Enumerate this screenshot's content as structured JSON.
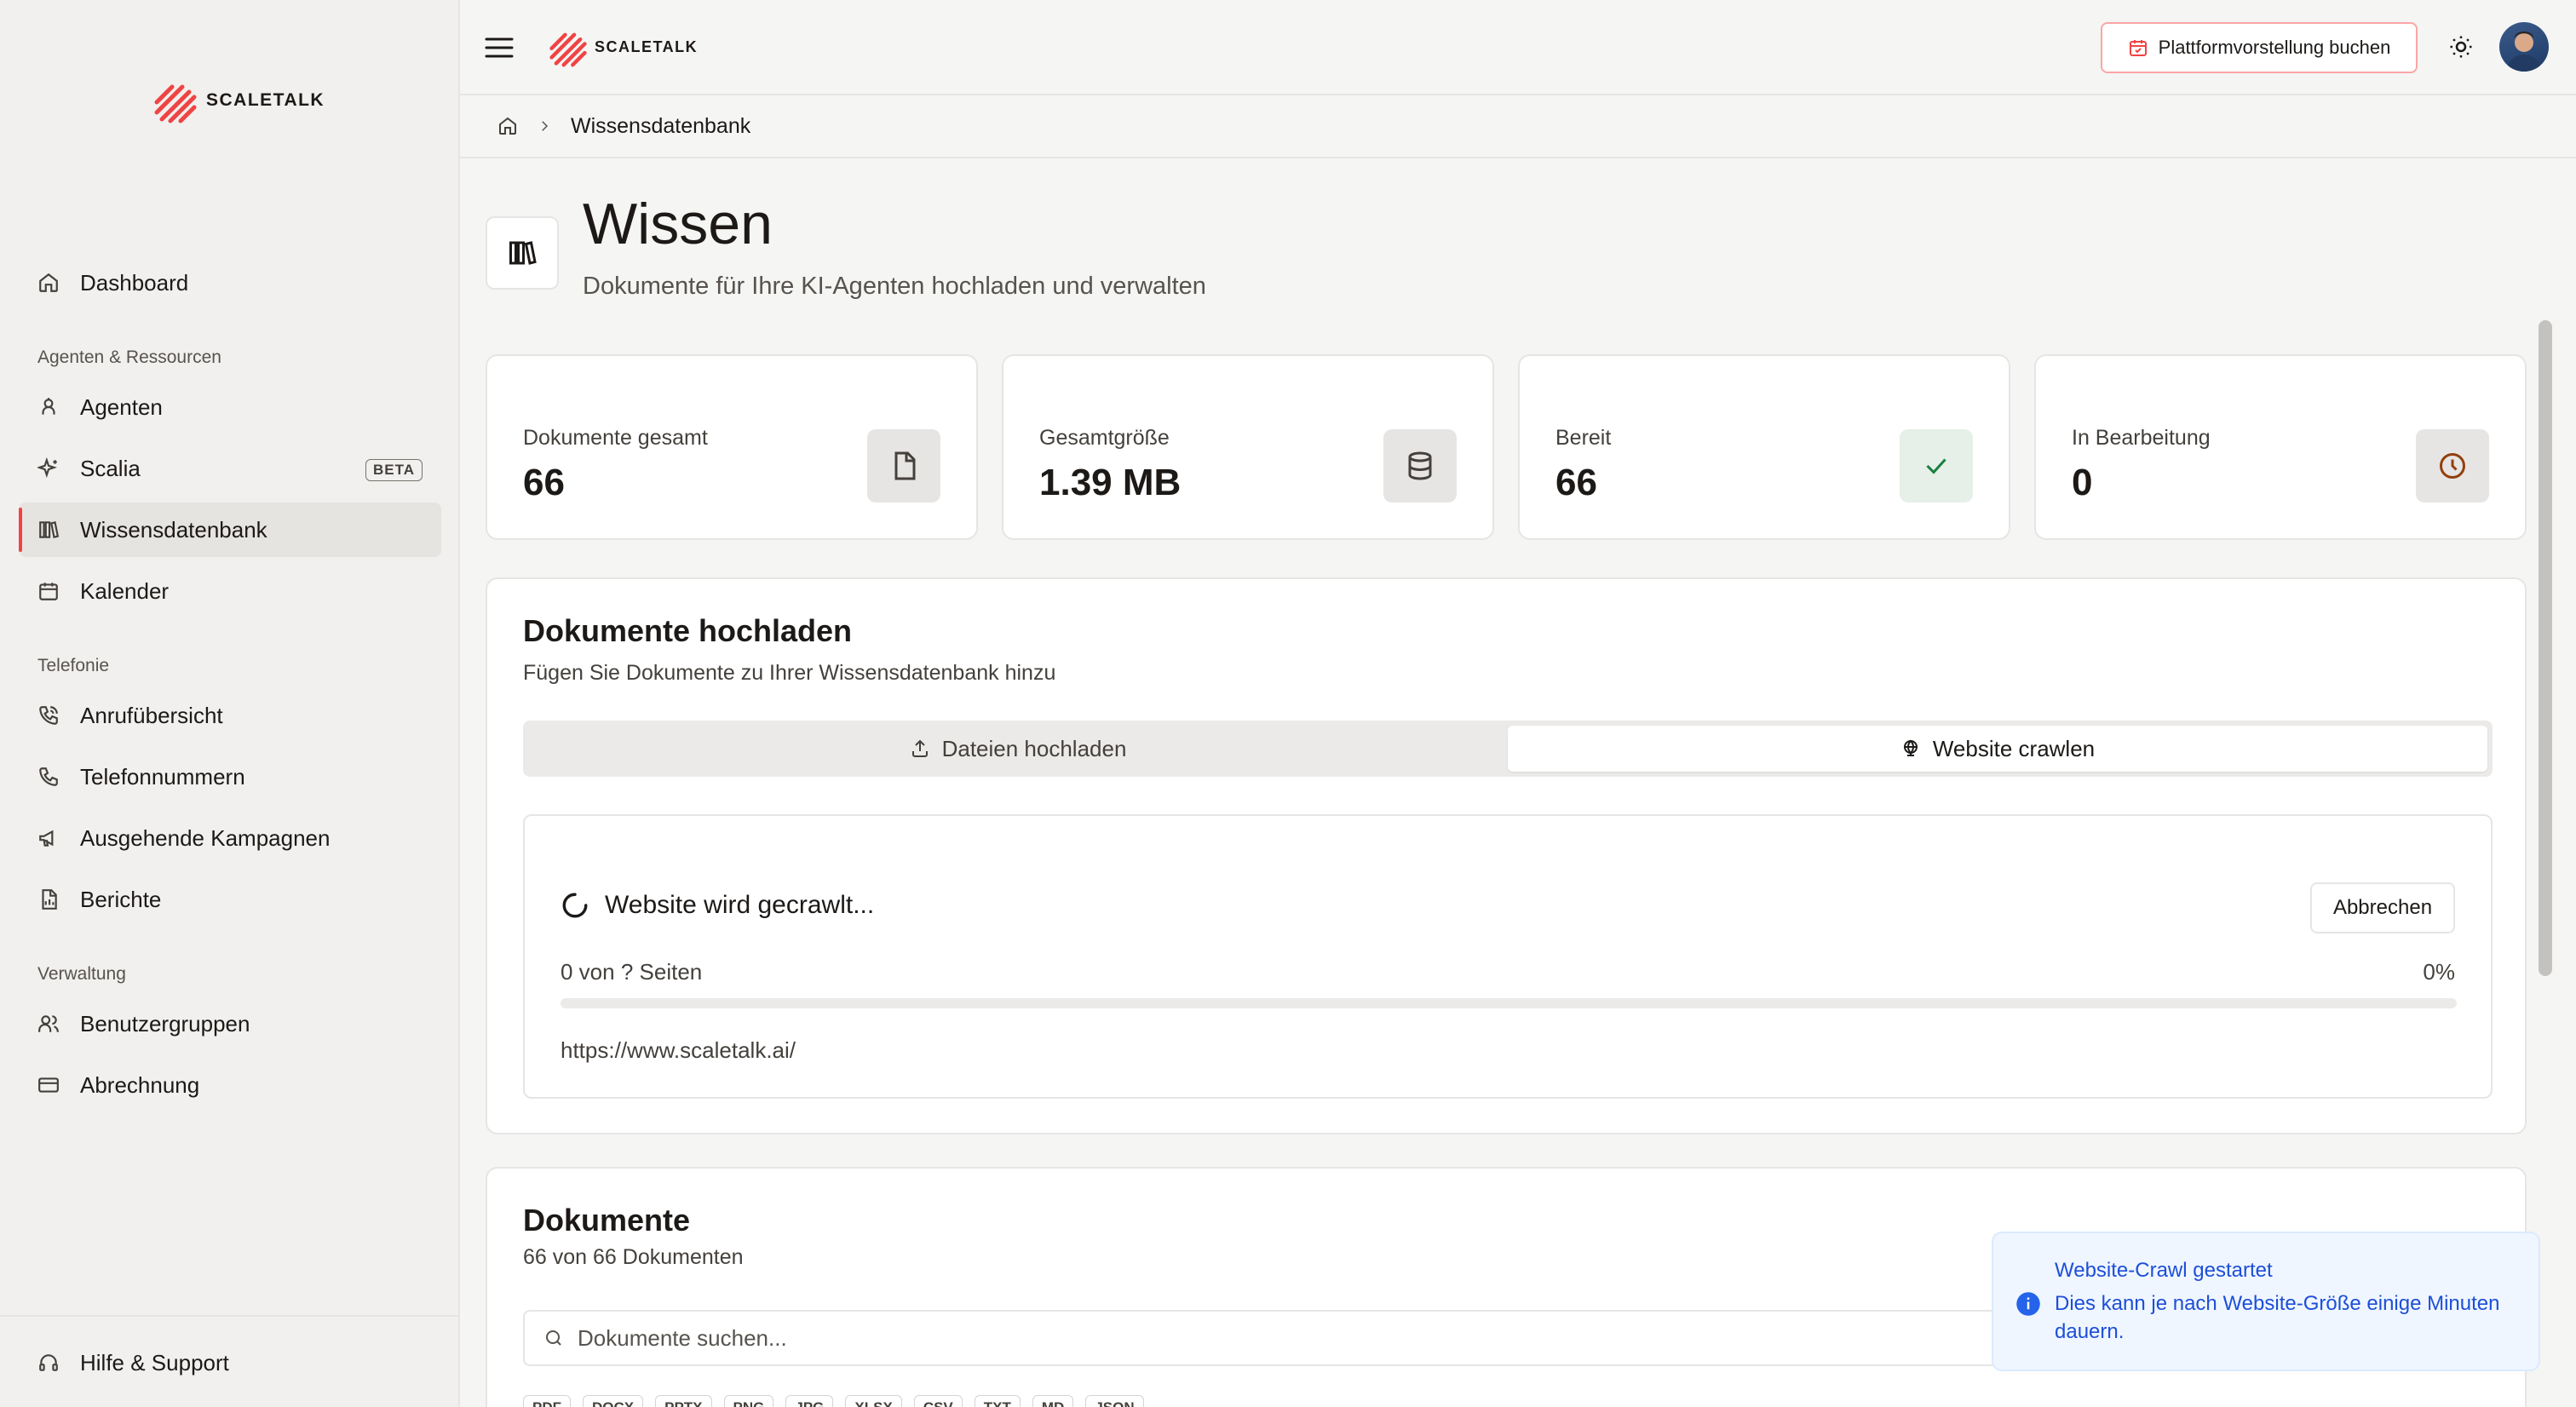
{
  "app": {
    "brand": "SCALETALK",
    "accent_color": "#ef4444"
  },
  "sidebar": {
    "items": [
      {
        "label": "Dashboard",
        "icon": "home-icon"
      },
      {
        "section": "Agenten & Ressourcen"
      },
      {
        "label": "Agenten",
        "icon": "bot-icon"
      },
      {
        "label": "Scalia",
        "icon": "sparkles-icon",
        "badge": "BETA"
      },
      {
        "label": "Wissensdatenbank",
        "icon": "library-icon",
        "active": true
      },
      {
        "label": "Kalender",
        "icon": "calendar-icon"
      },
      {
        "section": "Telefonie"
      },
      {
        "label": "Anrufübersicht",
        "icon": "phone-call-icon"
      },
      {
        "label": "Telefonnummern",
        "icon": "phone-icon"
      },
      {
        "label": "Ausgehende Kampagnen",
        "icon": "megaphone-icon"
      },
      {
        "label": "Berichte",
        "icon": "file-chart-icon"
      },
      {
        "section": "Verwaltung"
      },
      {
        "label": "Benutzergruppen",
        "icon": "users-icon"
      },
      {
        "label": "Abrechnung",
        "icon": "credit-card-icon"
      }
    ],
    "footer": {
      "label": "Hilfe & Support",
      "icon": "headset-icon"
    }
  },
  "topbar": {
    "demo_button": "Plattformvorstellung buchen"
  },
  "breadcrumb": {
    "current": "Wissensdatenbank"
  },
  "page": {
    "title": "Wissen",
    "subtitle": "Dokumente für Ihre KI-Agenten hochladen und verwalten"
  },
  "stats": [
    {
      "label": "Dokumente gesamt",
      "value": "66",
      "icon": "file-icon"
    },
    {
      "label": "Gesamtgröße",
      "value": "1.39 MB",
      "icon": "database-icon"
    },
    {
      "label": "Bereit",
      "value": "66",
      "icon": "check-icon"
    },
    {
      "label": "In Bearbeitung",
      "value": "0",
      "icon": "clock-icon"
    }
  ],
  "upload": {
    "title": "Dokumente hochladen",
    "subtitle": "Fügen Sie Dokumente zu Ihrer Wissensdatenbank hinzu",
    "tabs": [
      {
        "label": "Dateien hochladen",
        "icon": "upload-icon"
      },
      {
        "label": "Website crawlen",
        "icon": "globe-icon",
        "active": true
      }
    ],
    "crawl": {
      "status": "Website wird gecrawlt...",
      "cancel": "Abbrechen",
      "pages": "0 von ? Seiten",
      "percent_label": "0%",
      "progress": 0,
      "url": "https://www.scaletalk.ai/"
    }
  },
  "documents": {
    "title": "Dokumente",
    "count": "66 von 66 Dokumenten",
    "search_placeholder": "Dokumente suchen...",
    "filters": [
      "PDF",
      "DOCX",
      "PPTX",
      "PNG",
      "JPG",
      "XLSX",
      "CSV",
      "TXT",
      "MD",
      "JSON"
    ]
  },
  "toast": {
    "title": "Website-Crawl gestartet",
    "message": "Dies kann je nach Website-Größe einige Minuten dauern."
  }
}
